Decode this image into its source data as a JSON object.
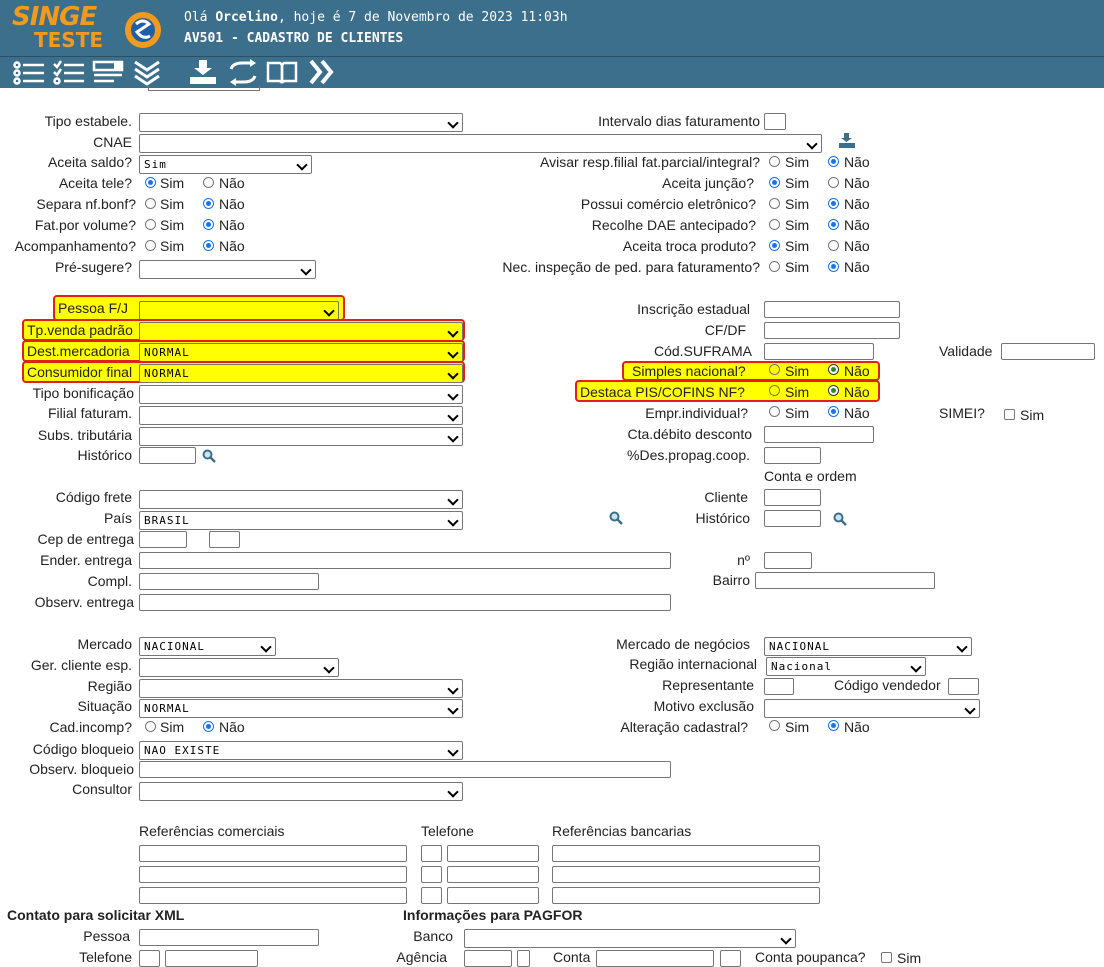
{
  "header": {
    "logo_line1": "SINGE",
    "logo_line2": "TESTE",
    "greeting_prefix": "Olá ",
    "user": "Orcelino",
    "greeting_suffix": ", hoje é 7 de Novembro de 2023 11:03h",
    "screen_title": "AV501 - CADASTRO DE CLIENTES"
  },
  "toolbar": {
    "icons": [
      "list-icon",
      "checklist-icon",
      "form-icon",
      "chevrons-down-icon",
      "download-icon",
      "swap-icon",
      "book-icon",
      "chevrons-right-icon"
    ]
  },
  "labels": {
    "tipo_estabele": "Tipo estabele.",
    "cnae": "CNAE",
    "aceita_saldo": "Aceita saldo?",
    "aceita_tele": "Aceita tele?",
    "separa_nf": "Separa nf.bonf?",
    "fat_volume": "Fat.por volume?",
    "acompanhamento": "Acompanhamento?",
    "pre_sugere": "Pré-sugere?",
    "intervalo": "Intervalo dias faturamento",
    "avisar": "Avisar resp.filial fat.parcial/integral?",
    "aceita_juncao": "Aceita junção?",
    "comercio_eletronico": "Possui comércio eletrônico?",
    "recolhe_dae": "Recolhe DAE antecipado?",
    "troca_produto": "Aceita troca produto?",
    "inspecao": "Nec. inspeção de ped. para faturamento?",
    "pessoa_fj": "Pessoa F/J",
    "tp_venda": "Tp.venda padrão",
    "dest_mercadoria": "Dest.mercadoria",
    "consumidor_final": "Consumidor final",
    "tipo_bonificacao": "Tipo bonificação",
    "filial_faturam": "Filial faturam.",
    "subs_tributaria": "Subs. tributária",
    "historico": "Histórico",
    "inscricao_estadual": "Inscrição estadual",
    "cf_df": "CF/DF",
    "cod_suframa": "Cód.SUFRAMA",
    "validade": "Validade",
    "simples_nacional": "Simples nacional?",
    "destaca_pis": "Destaca PIS/COFINS NF?",
    "empr_individual": "Empr.individual?",
    "simei": "SIMEI?",
    "cta_debito": "Cta.débito desconto",
    "des_propag": "%Des.propag.coop.",
    "conta_ordem": "Conta e ordem",
    "cliente": "Cliente",
    "historico2": "Histórico",
    "codigo_frete": "Código frete",
    "pais": "País",
    "cep_entrega": "Cep de entrega",
    "ender_entrega": "Ender. entrega",
    "compl": "Compl.",
    "observ_entrega": "Observ. entrega",
    "numero": "nº",
    "bairro": "Bairro",
    "mercado": "Mercado",
    "ger_cliente": "Ger. cliente esp.",
    "regiao": "Região",
    "situacao": "Situação",
    "cad_incomp": "Cad.incomp?",
    "codigo_bloqueio": "Código bloqueio",
    "observ_bloqueio": "Observ. bloqueio",
    "consultor": "Consultor",
    "mercado_negocios": "Mercado de negócios",
    "regiao_internacional": "Região internacional",
    "representante": "Representante",
    "codigo_vendedor": "Código vendedor",
    "motivo_exclusao": "Motivo exclusão",
    "alteracao_cadastral": "Alteração cadastral?",
    "ref_comerciais": "Referências comerciais",
    "telefone_col": "Telefone",
    "ref_bancarias": "Referências bancarias",
    "contato_xml": "Contato para solicitar XML",
    "info_pagfor": "Informações para PAGFOR",
    "pessoa": "Pessoa",
    "telefone": "Telefone",
    "banco": "Banco",
    "agencia": "Agência",
    "conta": "Conta",
    "conta_poupanca": "Conta poupanca?"
  },
  "options": {
    "sim": "Sim",
    "nao": "Não"
  },
  "values": {
    "aceita_saldo": "Sim",
    "dest_mercadoria": "NORMAL",
    "consumidor_final": "NORMAL",
    "pais": "BRASIL",
    "mercado": "NACIONAL",
    "situacao": "NORMAL",
    "codigo_bloqueio": "NAO EXISTE",
    "mercado_negocios": "NACIONAL",
    "regiao_internacional": "Nacional"
  },
  "colors": {
    "header_bg": "#3c6f8c",
    "logo": "#f39a1d",
    "highlight": "#ffff00",
    "highlight_border": "#e0201a",
    "radio_selected": "#1a73e8"
  }
}
